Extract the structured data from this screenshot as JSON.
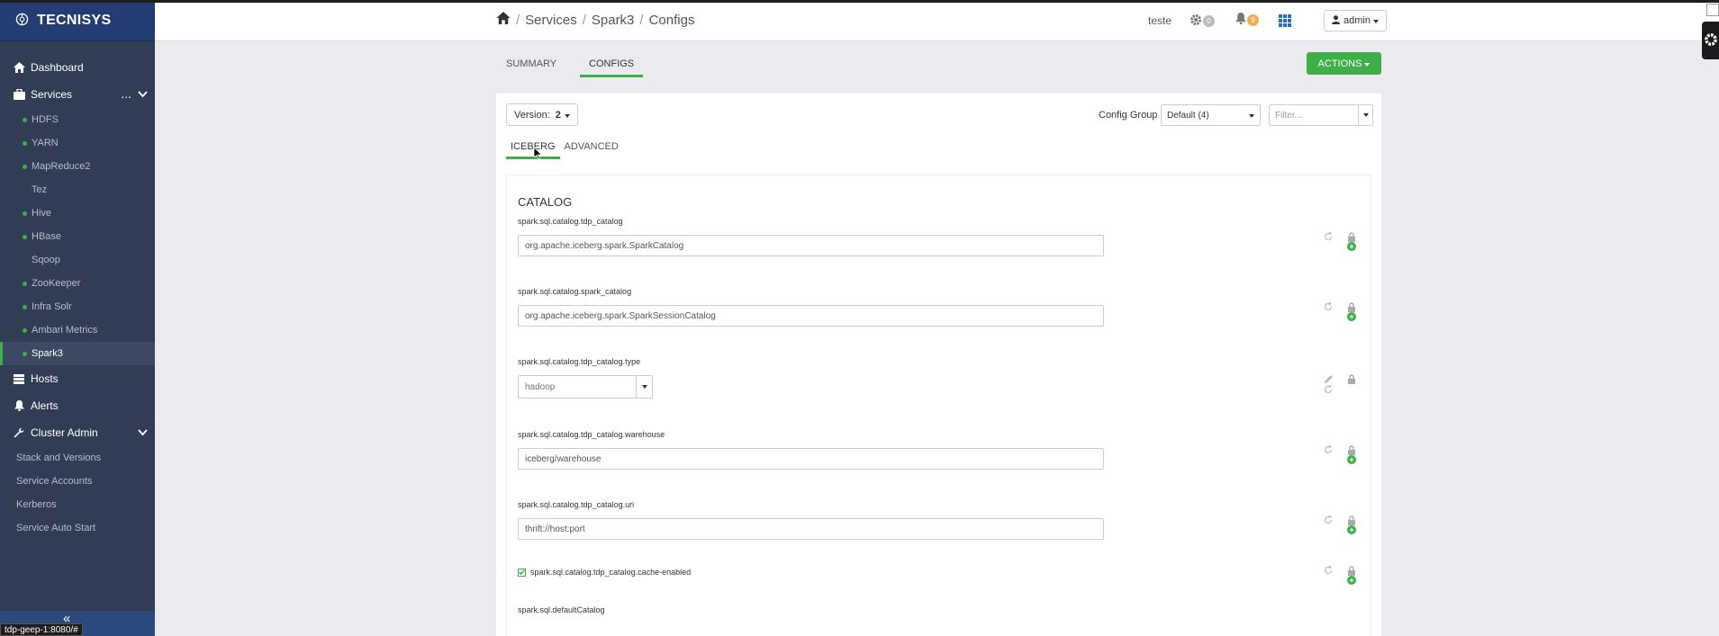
{
  "brand": {
    "name": "TECNISYS"
  },
  "sidebar": {
    "dashboard": "Dashboard",
    "services": "Services",
    "services_more": "...",
    "service_items": [
      {
        "label": "HDFS",
        "status": "green"
      },
      {
        "label": "YARN",
        "status": "green"
      },
      {
        "label": "MapReduce2",
        "status": "green"
      },
      {
        "label": "Tez",
        "status": "none"
      },
      {
        "label": "Hive",
        "status": "green"
      },
      {
        "label": "HBase",
        "status": "green"
      },
      {
        "label": "Sqoop",
        "status": "none"
      },
      {
        "label": "ZooKeeper",
        "status": "green"
      },
      {
        "label": "Infra Solr",
        "status": "green"
      },
      {
        "label": "Ambari Metrics",
        "status": "green"
      },
      {
        "label": "Spark3",
        "status": "green",
        "active": true
      }
    ],
    "hosts": "Hosts",
    "alerts": "Alerts",
    "cluster_admin": "Cluster Admin",
    "admin_items": [
      "Stack and Versions",
      "Service Accounts",
      "Kerberos",
      "Service Auto Start"
    ],
    "collapse": "«"
  },
  "status_url": "tdp-geep-1:8080/#",
  "topbar": {
    "breadcrumb": [
      "Services",
      "Spark3",
      "Configs"
    ],
    "cluster_name": "teste",
    "ops_count": "0",
    "alerts_count": "9",
    "user": "admin"
  },
  "tabs": {
    "summary": "SUMMARY",
    "configs": "CONFIGS"
  },
  "actions_label": "ACTIONS",
  "version": {
    "label": "Version:",
    "value": "2"
  },
  "config_group": {
    "label": "Config Group",
    "value": "Default (4)"
  },
  "filter": {
    "placeholder": "Filter..."
  },
  "subtabs": {
    "iceberg": "ICEBERG",
    "advanced": "ADVANCED"
  },
  "section": {
    "title": "CATALOG",
    "props": [
      {
        "name": "spark.sql.catalog.tdp_catalog",
        "value": "org.apache.iceberg.spark.SparkCatalog",
        "kind": "text"
      },
      {
        "name": "spark.sql.catalog.spark_catalog",
        "value": "org.apache.iceberg.spark.SparkSessionCatalog",
        "kind": "text"
      },
      {
        "name": "spark.sql.catalog.tdp_catalog.type",
        "value": "hadoop",
        "kind": "select"
      },
      {
        "name": "spark.sql.catalog.tdp_catalog.warehouse",
        "value": "iceberg/warehouse",
        "kind": "text"
      },
      {
        "name": "spark.sql.catalog.tdp_catalog.uri",
        "value": "thrift://host:port",
        "kind": "text"
      },
      {
        "name": "spark.sql.catalog.tdp_catalog.cache-enabled",
        "value": "true",
        "kind": "checkbox"
      },
      {
        "name": "spark.sql.defaultCatalog",
        "value": "",
        "kind": "text"
      }
    ]
  },
  "colors": {
    "accent": "#3fae49",
    "sidebar": "#313d54",
    "brand_bar": "#233d72"
  }
}
